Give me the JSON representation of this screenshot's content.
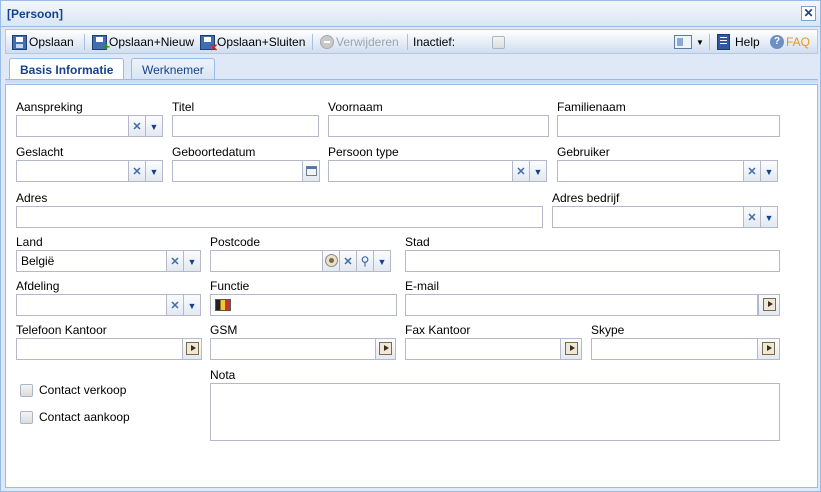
{
  "window": {
    "title": "[Persoon]"
  },
  "toolbar": {
    "save_label": "Opslaan",
    "save_new_label": "Opslaan+Nieuw",
    "save_close_label": "Opslaan+Sluiten",
    "delete_label": "Verwijderen",
    "inactive_label": "Inactief:",
    "inactive_checked": false,
    "help_label": "Help",
    "faq_label": "FAQ"
  },
  "tabs": [
    {
      "label": "Basis Informatie",
      "active": true
    },
    {
      "label": "Werknemer",
      "active": false
    }
  ],
  "form": {
    "aanspreking": {
      "label": "Aanspreking",
      "value": ""
    },
    "titel": {
      "label": "Titel",
      "value": ""
    },
    "voornaam": {
      "label": "Voornaam",
      "value": ""
    },
    "familienaam": {
      "label": "Familienaam",
      "value": ""
    },
    "geslacht": {
      "label": "Geslacht",
      "value": ""
    },
    "geboortedatum": {
      "label": "Geboortedatum",
      "value": ""
    },
    "persoon_type": {
      "label": "Persoon type",
      "value": ""
    },
    "gebruiker": {
      "label": "Gebruiker",
      "value": ""
    },
    "adres": {
      "label": "Adres",
      "value": ""
    },
    "adres_bedrijf": {
      "label": "Adres bedrijf",
      "value": ""
    },
    "land": {
      "label": "Land",
      "value": "België"
    },
    "postcode": {
      "label": "Postcode",
      "value": ""
    },
    "stad": {
      "label": "Stad",
      "value": ""
    },
    "afdeling": {
      "label": "Afdeling",
      "value": ""
    },
    "functie": {
      "label": "Functie",
      "value": ""
    },
    "email": {
      "label": "E-mail",
      "value": ""
    },
    "telefoon_kantoor": {
      "label": "Telefoon Kantoor",
      "value": ""
    },
    "gsm": {
      "label": "GSM",
      "value": ""
    },
    "fax_kantoor": {
      "label": "Fax Kantoor",
      "value": ""
    },
    "skype": {
      "label": "Skype",
      "value": ""
    },
    "nota": {
      "label": "Nota",
      "value": ""
    },
    "contact_verkoop": {
      "label": "Contact verkoop",
      "checked": false
    },
    "contact_aankoop": {
      "label": "Contact aankoop",
      "checked": false
    }
  },
  "colors": {
    "accent": "#15428b",
    "border": "#99bbe8",
    "window_bg": "#dfe8f6",
    "faq": "#e8941a"
  },
  "icons": {
    "save": "save-icon",
    "save_new": "save-new-icon",
    "save_close": "save-close-icon",
    "delete": "delete-icon",
    "layout": "layout-icon",
    "help": "help-book-icon",
    "faq": "faq-icon",
    "clear": "clear-x-icon",
    "dropdown": "chevron-down-icon",
    "calendar": "calendar-icon",
    "search": "search-icon",
    "go": "go-arrow-icon",
    "flag": "flag-icon"
  }
}
